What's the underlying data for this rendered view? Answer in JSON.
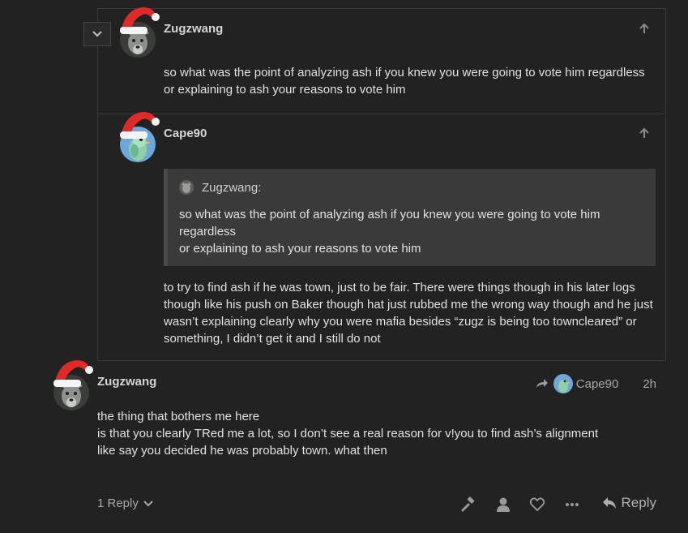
{
  "posts": [
    {
      "username": "Zugzwang",
      "lines": [
        "so what was the point of analyzing ash if you knew you were going to vote him regardless",
        "or explaining to ash your reasons to vote him"
      ]
    },
    {
      "username": "Cape90",
      "quote": {
        "author": "Zugzwang:",
        "lines": [
          "so what was the point of analyzing ash if you knew you were going to vote him",
          "regardless",
          "or explaining to ash your reasons to vote him"
        ]
      },
      "lines": [
        "to try to find ash if he was town, just to be fair. There were things though in his later logs",
        "though like his push on Baker though hat just rubbed me the wrong way though and he just",
        "wasn’t explaining clearly why you were mafia besides “zugz is being too towncleared” or",
        "something, I didn’t get it and I still do not"
      ]
    },
    {
      "username": "Zugzwang",
      "reply_to": "Cape90",
      "time": "2h",
      "lines": [
        "the thing that bothers me here",
        "is that you clearly TRed me a lot, so I don’t see a real reason for v!you to find ash’s alignment",
        "like say you decided he was probably town. what then"
      ]
    }
  ],
  "actions": {
    "replies_label": "1 Reply",
    "reply_label": "Reply",
    "icons": [
      "gavel-icon",
      "user-icon",
      "heart-icon",
      "more-icon",
      "reply-icon"
    ]
  },
  "colors": {
    "background": "#222222",
    "quote_bg": "#3a3a3a",
    "text": "#e2e2e2",
    "muted": "#a8a8a8",
    "hat_red": "#e02a2a"
  }
}
